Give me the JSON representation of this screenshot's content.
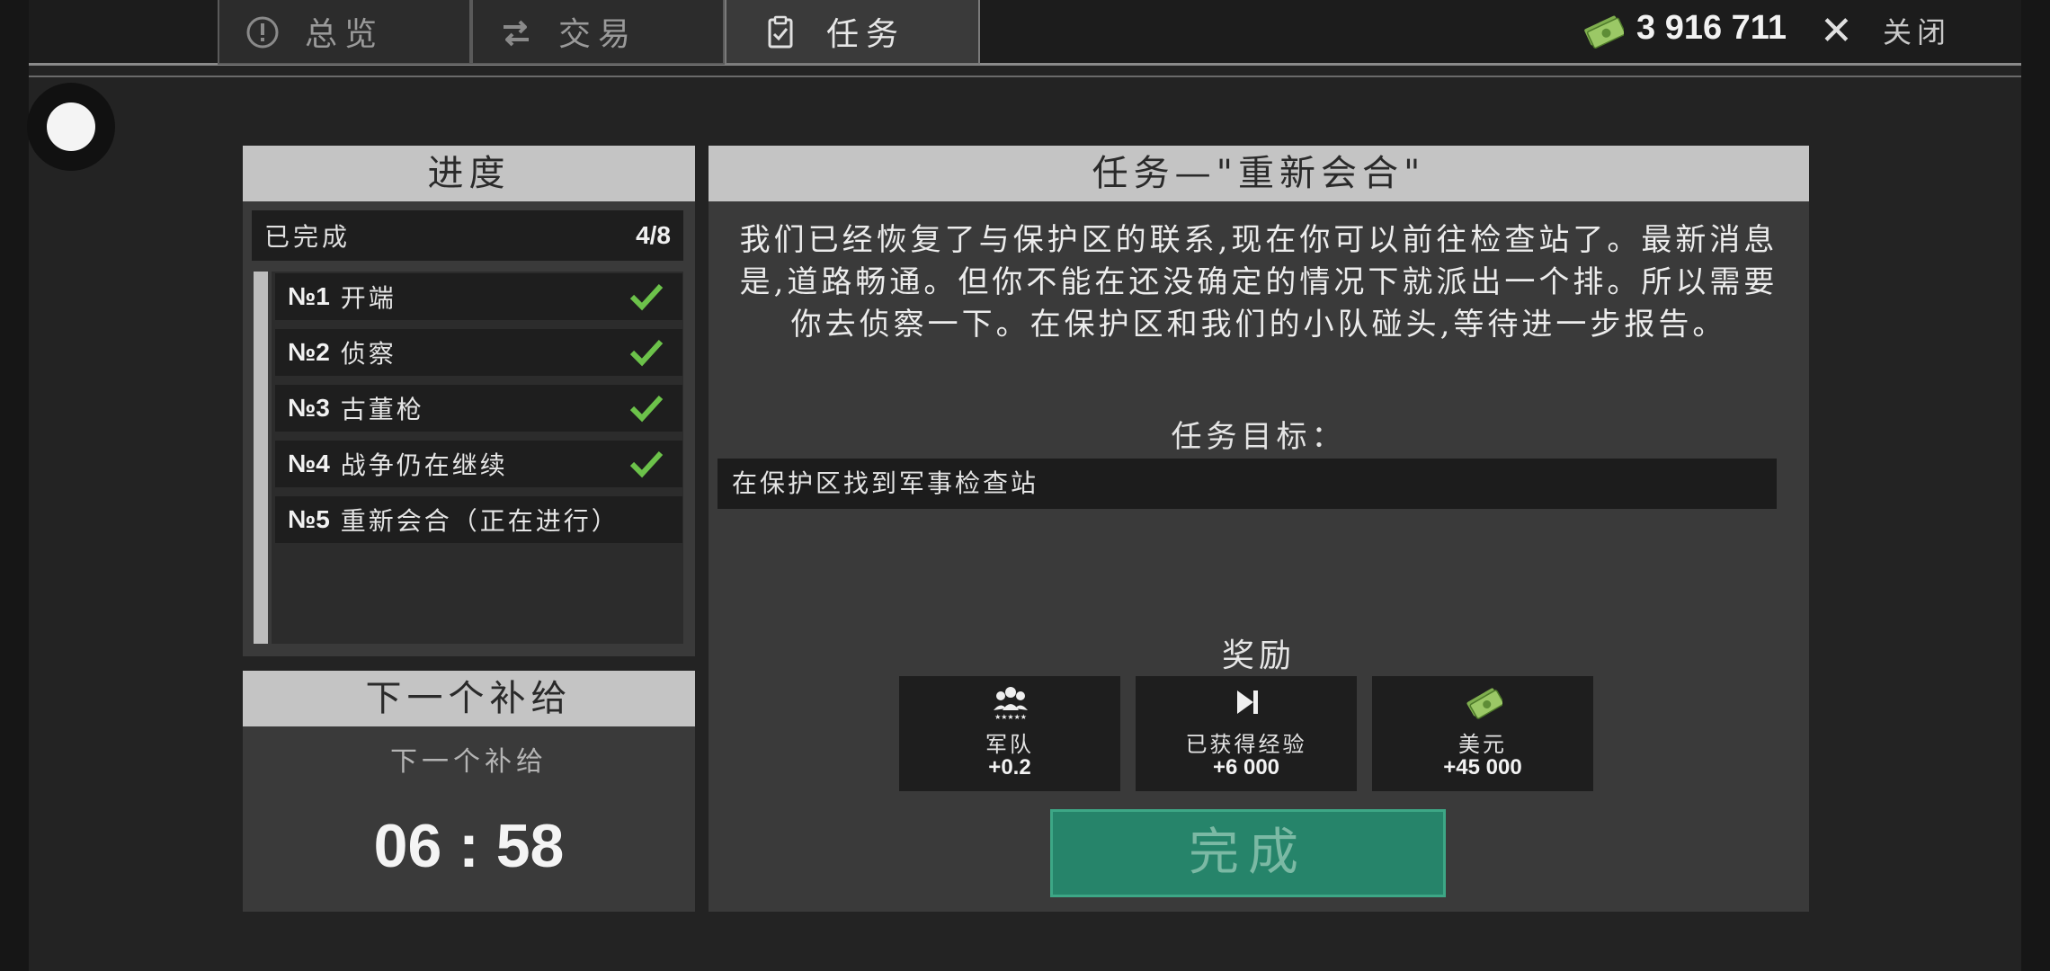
{
  "tabs": [
    {
      "label": "总览",
      "icon": "alert-circle-icon",
      "active": false
    },
    {
      "label": "交易",
      "icon": "swap-arrows-icon",
      "active": false
    },
    {
      "label": "任务",
      "icon": "clipboard-check-icon",
      "active": true
    }
  ],
  "header": {
    "money": "3 916 711",
    "money_icon": "cash-icon",
    "close_label": "关闭"
  },
  "progress": {
    "title": "进度",
    "completed_label": "已完成",
    "completed_count": "4/8",
    "missions": [
      {
        "num": "№1",
        "name": "开端",
        "done": true
      },
      {
        "num": "№2",
        "name": "侦察",
        "done": true
      },
      {
        "num": "№3",
        "name": "古董枪",
        "done": true
      },
      {
        "num": "№4",
        "name": "战争仍在继续",
        "done": true
      },
      {
        "num": "№5",
        "name": "重新会合（正在进行）",
        "done": false
      }
    ]
  },
  "supply": {
    "title": "下一个补给",
    "subtitle": "下一个补给",
    "timer": "06 : 58"
  },
  "mission": {
    "title": "任务—\"重新会合\"",
    "description": "我们已经恢复了与保护区的联系,现在你可以前往检查站了。最新消息是,道路畅通。但你不能在还没确定的情况下就派出一个排。所以需要你去侦察一下。在保护区和我们的小队碰头,等待进一步报告。",
    "objective_label": "任务目标：",
    "objective": "在保护区找到军事检查站",
    "rewards_title": "奖励",
    "rewards": [
      {
        "icon": "troops-icon",
        "label": "军队",
        "value": "+0.2"
      },
      {
        "icon": "experience-icon",
        "label": "已获得经验",
        "value": "+6 000"
      },
      {
        "icon": "cash-icon",
        "label": "美元",
        "value": "+45 000"
      }
    ],
    "complete_label": "完成"
  },
  "colors": {
    "accent_green": "#26846a",
    "check_green": "#6cc24a",
    "header_grey": "#c4c4c4"
  }
}
